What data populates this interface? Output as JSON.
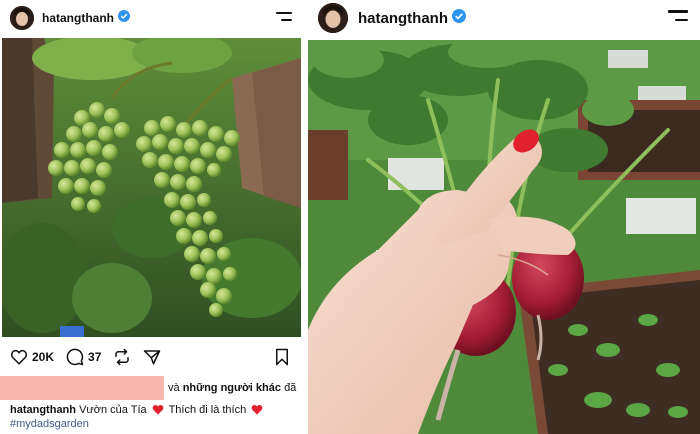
{
  "left_post": {
    "username": "hatangthanh",
    "verified": true,
    "photo": {
      "subject": "green grape cluster",
      "icon": "grape-photo"
    },
    "actions": {
      "like_icon": "heart-outline-icon",
      "like_count": "20K",
      "comment_icon": "comment-bubble-icon",
      "comment_count": "37",
      "repost_icon": "repost-icon",
      "share_icon": "send-icon",
      "save_icon": "bookmark-icon"
    },
    "liked_by_redacted": true,
    "liked_by_prefix": "và",
    "liked_by_others": "những người khác",
    "liked_by_suffix": "đã",
    "caption_username": "hatangthanh",
    "caption_text_1": "Vườn của Tía",
    "caption_text_2": "Thích đi là thích",
    "hashtag": "#mydadsgarden"
  },
  "right_post": {
    "username": "hatangthanh",
    "verified": true,
    "photo": {
      "subject": "hand holding radishes",
      "icon": "radish-photo"
    }
  },
  "colors": {
    "verified_blue": "#2d95f0",
    "heart_red": "#e2202e",
    "hashtag_blue": "#3f5a8c",
    "redaction_pink": "#f8b7ae"
  }
}
